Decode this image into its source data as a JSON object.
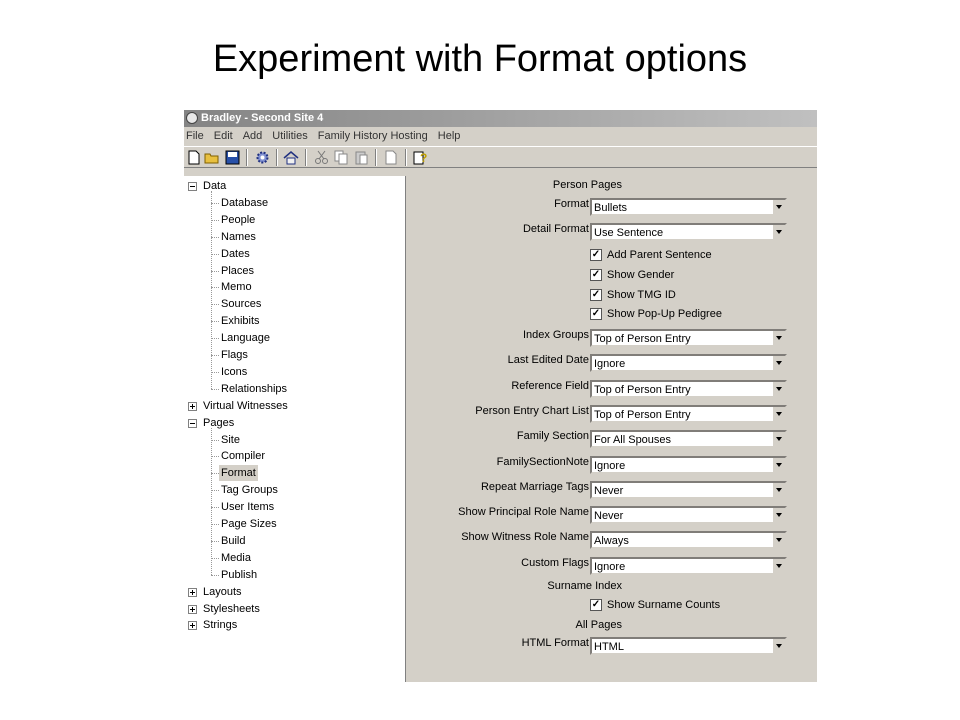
{
  "slide_title": "Experiment with Format options",
  "window": {
    "title": "Bradley - Second Site 4",
    "menu": [
      "File",
      "Edit",
      "Add",
      "Utilities",
      "Family History Hosting",
      "Help"
    ]
  },
  "toolbar": {
    "icons": [
      "new-file-icon",
      "open-folder-icon",
      "save-icon",
      "settings-gear-icon",
      "home-icon",
      "cut-icon",
      "copy-icon",
      "paste-icon",
      "blank-page-icon",
      "help-icon"
    ]
  },
  "tree": {
    "nodes": [
      {
        "label": "Data",
        "level": 0,
        "expander": "minus"
      },
      {
        "label": "Database",
        "level": 1
      },
      {
        "label": "People",
        "level": 1
      },
      {
        "label": "Names",
        "level": 1
      },
      {
        "label": "Dates",
        "level": 1
      },
      {
        "label": "Places",
        "level": 1
      },
      {
        "label": "Memo",
        "level": 1
      },
      {
        "label": "Sources",
        "level": 1
      },
      {
        "label": "Exhibits",
        "level": 1
      },
      {
        "label": "Language",
        "level": 1
      },
      {
        "label": "Flags",
        "level": 1
      },
      {
        "label": "Icons",
        "level": 1
      },
      {
        "label": "Relationships",
        "level": 1
      },
      {
        "label": "Virtual Witnesses",
        "level": 0,
        "expander": "plus"
      },
      {
        "label": "Pages",
        "level": 0,
        "expander": "minus"
      },
      {
        "label": "Site",
        "level": 1
      },
      {
        "label": "Compiler",
        "level": 1
      },
      {
        "label": "Format",
        "level": 1,
        "selected": true
      },
      {
        "label": "Tag Groups",
        "level": 1
      },
      {
        "label": "User Items",
        "level": 1
      },
      {
        "label": "Page Sizes",
        "level": 1
      },
      {
        "label": "Build",
        "level": 1
      },
      {
        "label": "Media",
        "level": 1
      },
      {
        "label": "Publish",
        "level": 1
      },
      {
        "label": "Layouts",
        "level": 0,
        "expander": "plus"
      },
      {
        "label": "Stylesheets",
        "level": 0,
        "expander": "plus"
      },
      {
        "label": "Strings",
        "level": 0,
        "expander": "plus"
      }
    ]
  },
  "form": {
    "person_pages_heading": "Person Pages",
    "format": {
      "label": "Format",
      "value": "Bullets"
    },
    "detail_format": {
      "label": "Detail Format",
      "value": "Use Sentence"
    },
    "checkboxes_person": [
      {
        "label": "Add Parent Sentence",
        "checked": true
      },
      {
        "label": "Show Gender",
        "checked": true
      },
      {
        "label": "Show TMG ID",
        "checked": true
      },
      {
        "label": "Show Pop-Up Pedigree",
        "checked": true
      }
    ],
    "selects": [
      {
        "label": "Index Groups",
        "value": "Top of Person Entry"
      },
      {
        "label": "Last Edited Date",
        "value": "Ignore"
      },
      {
        "label": "Reference Field",
        "value": "Top of Person Entry"
      },
      {
        "label": "Person Entry Chart List",
        "value": "Top of Person Entry"
      },
      {
        "label": "Family Section",
        "value": "For All Spouses"
      },
      {
        "label": "FamilySectionNote",
        "value": "Ignore"
      },
      {
        "label": "Repeat Marriage Tags",
        "value": "Never"
      },
      {
        "label": "Show Principal Role Name",
        "value": "Never"
      },
      {
        "label": "Show Witness Role Name",
        "value": "Always"
      },
      {
        "label": "Custom Flags",
        "value": "Ignore"
      }
    ],
    "surname_index_heading": "Surname Index",
    "show_surname_counts": {
      "label": "Show Surname Counts",
      "checked": true
    },
    "all_pages_heading": "All Pages",
    "html_format": {
      "label": "HTML Format",
      "value": "HTML"
    }
  }
}
